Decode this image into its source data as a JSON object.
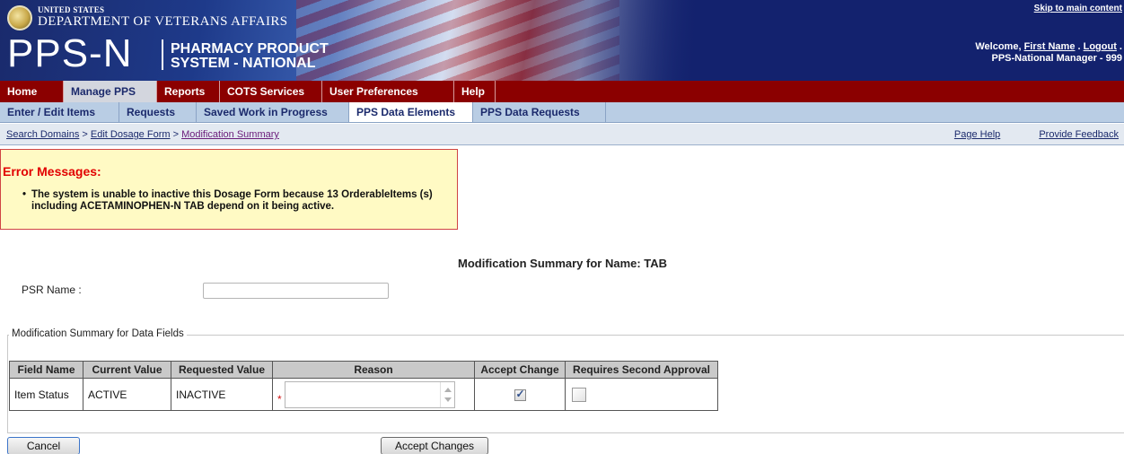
{
  "header": {
    "dept_line1": "UNITED STATES",
    "dept_line2": "DEPARTMENT OF VETERANS AFFAIRS",
    "brand": "PPS-N",
    "brand_sub1": "PHARMACY PRODUCT",
    "brand_sub2": "SYSTEM - NATIONAL",
    "skip_link": "Skip to main content",
    "welcome_prefix": "Welcome, ",
    "user_name": "First Name",
    "sep": " . ",
    "logout": "Logout",
    "logout_suffix": " .",
    "role": "PPS-National Manager - 999"
  },
  "topnav": [
    {
      "label": "Home"
    },
    {
      "label": "Manage PPS"
    },
    {
      "label": "Reports"
    },
    {
      "label": "COTS Services"
    },
    {
      "label": "User Preferences"
    },
    {
      "label": "Help"
    }
  ],
  "subnav": [
    {
      "label": "Enter / Edit Items"
    },
    {
      "label": "Requests"
    },
    {
      "label": "Saved Work in Progress"
    },
    {
      "label": "PPS Data Elements"
    },
    {
      "label": "PPS Data Requests"
    }
  ],
  "breadcrumb": {
    "items": [
      "Search Domains",
      "Edit Dosage Form",
      "Modification Summary"
    ],
    "separator": " > "
  },
  "help_links": {
    "page_help": "Page Help",
    "feedback": "Provide Feedback"
  },
  "error": {
    "title": "Error Messages:",
    "bullet": "•",
    "message": "The system is unable to inactive this Dosage Form because 13 OrderableItems (s) including ACETAMINOPHEN-N TAB depend on it being active."
  },
  "summary_title": "Modification Summary for Name: TAB",
  "psr": {
    "label": "PSR Name :",
    "value": ""
  },
  "fieldset_legend": "Modification Summary for Data Fields",
  "table": {
    "headers": [
      "Field Name",
      "Current Value",
      "Requested Value",
      "Reason",
      "Accept Change",
      "Requires Second Approval"
    ],
    "rows": [
      {
        "field": "Item Status",
        "current": "ACTIVE",
        "requested": "INACTIVE",
        "reason": "",
        "required_marker": "*",
        "accept": true,
        "second_approval": false
      }
    ]
  },
  "buttons": {
    "cancel": "Cancel",
    "accept": "Accept Changes"
  }
}
